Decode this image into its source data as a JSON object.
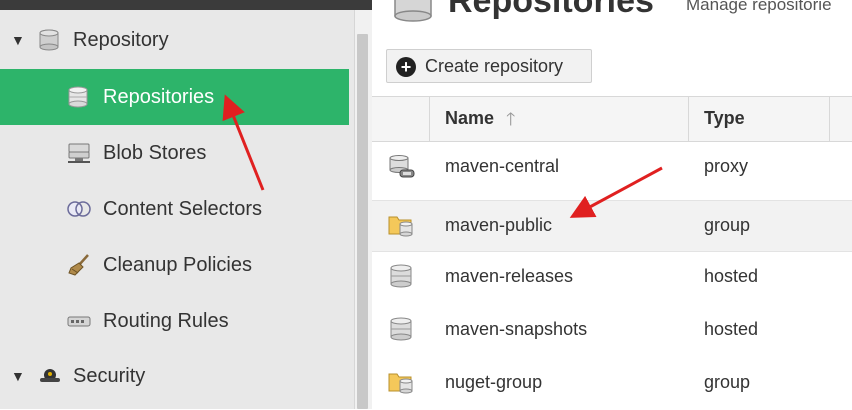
{
  "sidebar": {
    "groups": [
      {
        "label": "Repository",
        "icon": "database-icon",
        "expanded": true
      },
      {
        "label": "Security",
        "icon": "security-icon",
        "expanded": true
      }
    ],
    "items": [
      {
        "label": "Repositories",
        "icon": "database-icon",
        "selected": true
      },
      {
        "label": "Blob Stores",
        "icon": "blob-store-icon"
      },
      {
        "label": "Content Selectors",
        "icon": "content-selector-icon"
      },
      {
        "label": "Cleanup Policies",
        "icon": "broom-icon"
      },
      {
        "label": "Routing Rules",
        "icon": "routing-rules-icon"
      }
    ]
  },
  "header": {
    "title": "Repositories",
    "subtitle": "Manage repositorie"
  },
  "toolbar": {
    "create_label": "Create repository"
  },
  "table": {
    "columns": [
      "Name",
      "Type"
    ],
    "sort": "ascending",
    "rows": [
      {
        "name": "maven-central",
        "type": "proxy",
        "icon": "proxy-repo-icon"
      },
      {
        "name": "maven-public",
        "type": "group",
        "icon": "group-repo-icon"
      },
      {
        "name": "maven-releases",
        "type": "hosted",
        "icon": "hosted-repo-icon"
      },
      {
        "name": "maven-snapshots",
        "type": "hosted",
        "icon": "hosted-repo-icon"
      },
      {
        "name": "nuget-group",
        "type": "group",
        "icon": "group-repo-icon"
      }
    ]
  },
  "colors": {
    "selected_bg": "#2db46a",
    "annotation_arrow": "#e02020",
    "sidebar_bg": "#e8e8e8"
  }
}
